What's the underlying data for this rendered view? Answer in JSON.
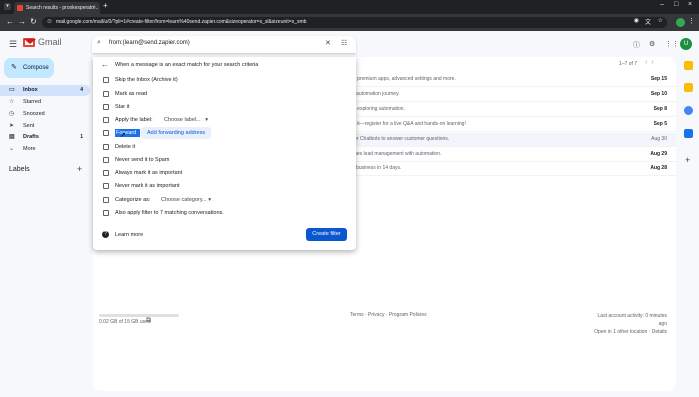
{
  "browser": {
    "tab_title": "Search results - proxkesperato...",
    "url": "mail.google.com/mail/u/0/?pli=1#create-filter/from=learn%40send.zapier.com&sizeoperator=s_sl&sizeunit=s_smb"
  },
  "gmail": {
    "brand": "Gmail",
    "search_query": "from:(learn@send.zapier.com)",
    "avatar_letter": "U"
  },
  "sidebar": {
    "compose": "Compose",
    "items": [
      {
        "label": "Inbox",
        "count": "4"
      },
      {
        "label": "Starred",
        "count": ""
      },
      {
        "label": "Snoozed",
        "count": ""
      },
      {
        "label": "Sent",
        "count": ""
      },
      {
        "label": "Drafts",
        "count": "1"
      },
      {
        "label": "More",
        "count": ""
      }
    ],
    "labels_title": "Labels"
  },
  "list": {
    "pager": "1–7 of 7",
    "rows": [
      {
        "snippet": "o premium apps, advanced settings and more.",
        "date": "Sep 15",
        "read": false
      },
      {
        "snippet": "r automation journey.",
        "date": "Sep 10",
        "read": false
      },
      {
        "snippet": "p exploring automation.",
        "date": "Sep 8",
        "read": false
      },
      {
        "snippet": "e it—register for a live Q&A and hands-on learning!",
        "date": "Sep 5",
        "read": false
      },
      {
        "snippet": "ier Chatbots to answer customer questions.",
        "date": "Aug 30",
        "read": true
      },
      {
        "snippet": "ines lead management with automation.",
        "date": "Aug 29",
        "read": false
      },
      {
        "snippet": "r business in 14 days.",
        "date": "Aug 28",
        "read": false
      }
    ]
  },
  "filter": {
    "heading": "When a message is an exact match for your search criteria",
    "options": [
      "Skip the Inbox (Archive it)",
      "Mark as read",
      "Star it",
      "Apply the label:",
      "Forward it",
      "Delete it",
      "Never send it to Spam",
      "Always mark it as important",
      "Never mark it as important",
      "Categorize as:",
      "Also apply filter to 7 matching conversations."
    ],
    "label_select": "Choose label...",
    "category_select": "Choose category...",
    "forward_selected": "Forward it",
    "forward_link": "Add forwarding address",
    "learn_more": "Learn more",
    "create_button": "Create filter"
  },
  "footer": {
    "storage": "0.02 GB of 15 GB used",
    "links": "Terms · Privacy · Program Policies",
    "activity_line1": "Last account activity: 0 minutes ago",
    "activity_line2": "Open in 1 other location · Details"
  },
  "colors": {
    "primary": "#0b57d0",
    "compose_bg": "#c2e7ff",
    "active_nav": "#d3e3fd"
  }
}
